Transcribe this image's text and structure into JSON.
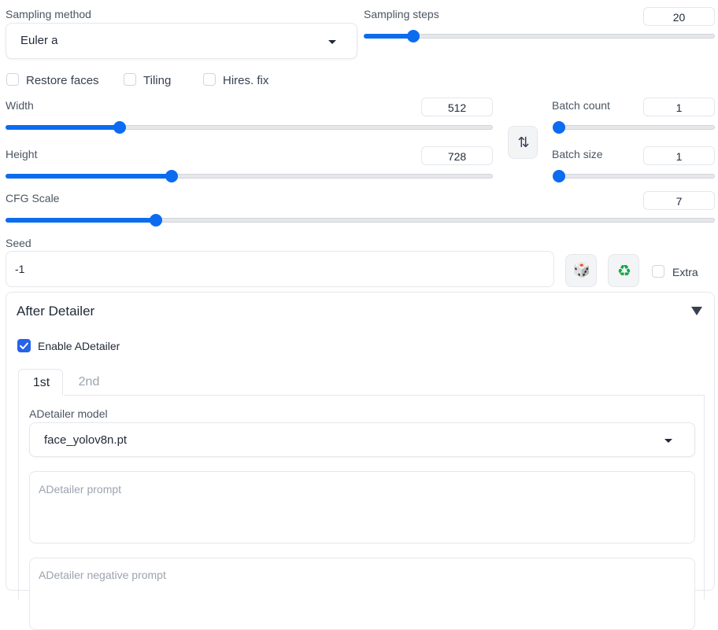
{
  "sampling_method": {
    "label": "Sampling method",
    "value": "Euler a"
  },
  "sampling_steps": {
    "label": "Sampling steps",
    "value": "20",
    "level": 0.13
  },
  "checkboxes": [
    {
      "label": "Restore faces",
      "checked": false
    },
    {
      "label": "Tiling",
      "checked": false
    },
    {
      "label": "Hires. fix",
      "checked": false
    }
  ],
  "width": {
    "label": "Width",
    "value": "512",
    "level": 0.23
  },
  "height": {
    "label": "Height",
    "value": "728",
    "level": 0.34
  },
  "batch_count": {
    "label": "Batch count",
    "value": "1",
    "level": 0.0
  },
  "batch_size": {
    "label": "Batch size",
    "value": "1",
    "level": 0.0
  },
  "swap_button": {
    "icon": "swap-vertical-icon",
    "glyph": "⇅"
  },
  "cfg_scale": {
    "label": "CFG Scale",
    "value": "7",
    "level": 0.21
  },
  "seed": {
    "label": "Seed",
    "value": "-1",
    "random_icon": "dice-icon",
    "random_glyph": "🎲",
    "reuse_icon": "recycle-icon",
    "reuse_glyph": "♻",
    "extra_label": "Extra"
  },
  "after_detailer": {
    "title": "After Detailer",
    "enable_label": "Enable ADetailer",
    "enabled": true,
    "tabs": [
      "1st",
      "2nd"
    ],
    "active_tab": "1st",
    "model_label": "ADetailer model",
    "model_value": "face_yolov8n.pt",
    "prompt_placeholder": "ADetailer prompt",
    "negative_prompt_placeholder": "ADetailer negative prompt"
  },
  "colors": {
    "accent": "#0b6cf0",
    "check": "#2563eb",
    "recycle": "#16a34a"
  }
}
